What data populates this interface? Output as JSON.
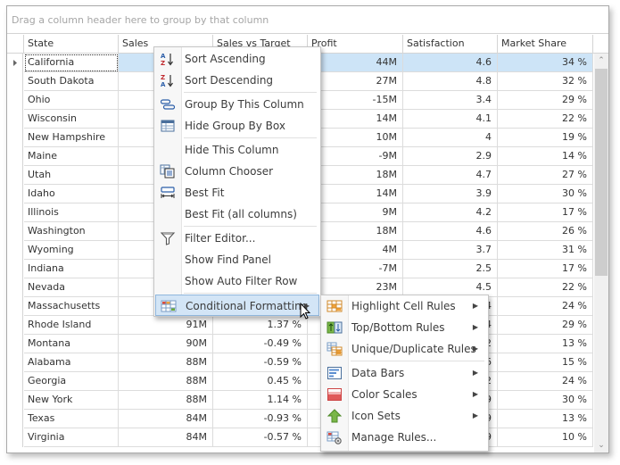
{
  "group_panel": {
    "placeholder": "Drag a column header here to group by that column"
  },
  "columns": [
    "State",
    "Sales",
    "Sales vs Target",
    "Profit",
    "Satisfaction",
    "Market Share"
  ],
  "rows": [
    {
      "state": "California",
      "sales": "",
      "target": "",
      "profit": "44M",
      "satisfaction": "4.6",
      "share": "34 %",
      "selected": true
    },
    {
      "state": "South Dakota",
      "sales": "",
      "target": "",
      "profit": "27M",
      "satisfaction": "4.8",
      "share": "32 %"
    },
    {
      "state": "Ohio",
      "sales": "",
      "target": "",
      "profit": "-15M",
      "satisfaction": "3.4",
      "share": "29 %"
    },
    {
      "state": "Wisconsin",
      "sales": "",
      "target": "",
      "profit": "14M",
      "satisfaction": "4.1",
      "share": "22 %"
    },
    {
      "state": "New Hampshire",
      "sales": "",
      "target": "",
      "profit": "10M",
      "satisfaction": "4",
      "share": "19 %"
    },
    {
      "state": "Maine",
      "sales": "",
      "target": "",
      "profit": "-9M",
      "satisfaction": "2.9",
      "share": "14 %"
    },
    {
      "state": "Utah",
      "sales": "",
      "target": "",
      "profit": "18M",
      "satisfaction": "4.7",
      "share": "27 %"
    },
    {
      "state": "Idaho",
      "sales": "",
      "target": "",
      "profit": "14M",
      "satisfaction": "3.9",
      "share": "30 %"
    },
    {
      "state": "Illinois",
      "sales": "",
      "target": "",
      "profit": "9M",
      "satisfaction": "4.2",
      "share": "17 %"
    },
    {
      "state": "Washington",
      "sales": "",
      "target": "",
      "profit": "18M",
      "satisfaction": "4.6",
      "share": "26 %"
    },
    {
      "state": "Wyoming",
      "sales": "",
      "target": "",
      "profit": "4M",
      "satisfaction": "3.7",
      "share": "31 %"
    },
    {
      "state": "Indiana",
      "sales": "",
      "target": "",
      "profit": "-7M",
      "satisfaction": "2.5",
      "share": "17 %"
    },
    {
      "state": "Nevada",
      "sales": "",
      "target": "",
      "profit": "23M",
      "satisfaction": "4.5",
      "share": "22 %"
    },
    {
      "state": "Massachusetts",
      "sales": "",
      "target": "",
      "profit": "",
      "satisfaction": "4",
      "share": "24 %"
    },
    {
      "state": "Rhode Island",
      "sales": "91M",
      "target": "1.37 %",
      "profit": "",
      "satisfaction": "4",
      "share": "29 %"
    },
    {
      "state": "Montana",
      "sales": "90M",
      "target": "-0.49 %",
      "profit": "",
      "satisfaction": "2",
      "share": "13 %"
    },
    {
      "state": "Alabama",
      "sales": "88M",
      "target": "-0.59 %",
      "profit": "",
      "satisfaction": "6",
      "share": "15 %"
    },
    {
      "state": "Georgia",
      "sales": "88M",
      "target": "0.45 %",
      "profit": "",
      "satisfaction": "2",
      "share": "24 %"
    },
    {
      "state": "New York",
      "sales": "88M",
      "target": "1.14 %",
      "profit": "",
      "satisfaction": "9",
      "share": "30 %"
    },
    {
      "state": "Texas",
      "sales": "84M",
      "target": "-0.93 %",
      "profit": "",
      "satisfaction": "9",
      "share": "13 %"
    },
    {
      "state": "Virginia",
      "sales": "84M",
      "target": "-0.57 %",
      "profit": "",
      "satisfaction": "9",
      "share": "10 %"
    }
  ],
  "context_menu": {
    "items": [
      {
        "label": "Sort Ascending",
        "icon": "sort-ascending-icon"
      },
      {
        "label": "Sort Descending",
        "icon": "sort-descending-icon"
      },
      {
        "label": "Group By This Column",
        "icon": "group-by-icon"
      },
      {
        "label": "Hide Group By Box",
        "icon": "group-box-icon"
      },
      {
        "label": "Hide This Column",
        "icon": ""
      },
      {
        "label": "Column Chooser",
        "icon": "column-chooser-icon"
      },
      {
        "label": "Best Fit",
        "icon": "best-fit-icon"
      },
      {
        "label": "Best Fit (all columns)",
        "icon": ""
      },
      {
        "label": "Filter Editor...",
        "icon": "filter-icon"
      },
      {
        "label": "Show Find Panel",
        "icon": ""
      },
      {
        "label": "Show Auto Filter Row",
        "icon": ""
      },
      {
        "label": "Conditional Formatting",
        "icon": "conditional-formatting-icon",
        "submenu": true,
        "highlighted": true
      }
    ]
  },
  "submenu": {
    "items": [
      {
        "label": "Highlight Cell Rules",
        "icon": "highlight-cell-rules-icon",
        "submenu": true
      },
      {
        "label": "Top/Bottom Rules",
        "icon": "top-bottom-rules-icon",
        "submenu": true
      },
      {
        "label": "Unique/Duplicate Rules",
        "icon": "unique-duplicate-rules-icon",
        "submenu": true
      },
      {
        "label": "Data Bars",
        "icon": "data-bars-icon",
        "submenu": true
      },
      {
        "label": "Color Scales",
        "icon": "color-scales-icon",
        "submenu": true
      },
      {
        "label": "Icon Sets",
        "icon": "icon-sets-icon",
        "submenu": true
      },
      {
        "label": "Manage Rules...",
        "icon": "manage-rules-icon"
      }
    ]
  },
  "colors": {
    "selection": "#cde4f7",
    "menu_highlight": "#d3e5f6"
  }
}
